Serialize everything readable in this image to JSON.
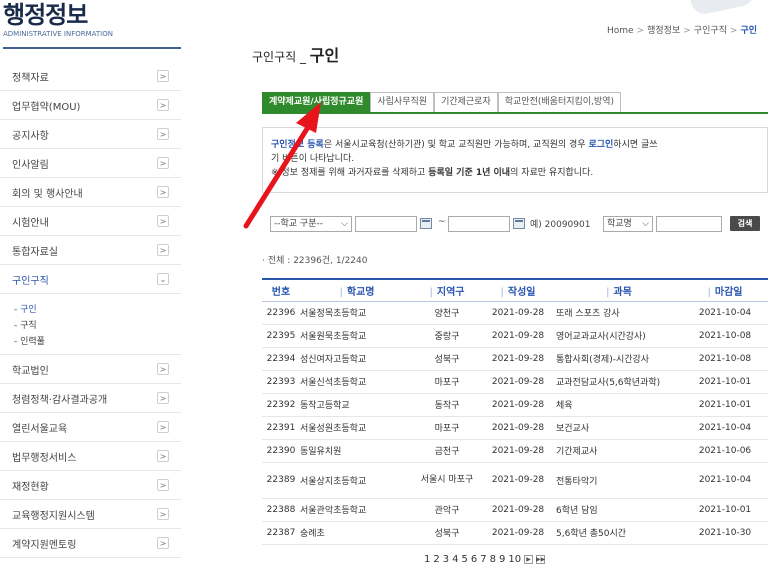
{
  "sidebar": {
    "title_ko": "행정정보",
    "title_en": "ADMINISTRATIVE INFORMATION",
    "items": [
      {
        "label": "정책자료"
      },
      {
        "label": "업무협약(MOU)"
      },
      {
        "label": "공지사항"
      },
      {
        "label": "인사알림"
      },
      {
        "label": "회의 및 행사안내"
      },
      {
        "label": "시험안내"
      },
      {
        "label": "통합자료실"
      },
      {
        "label": "구인구직"
      },
      {
        "label": "학교법인"
      },
      {
        "label": "청렴정책·감사결과공개"
      },
      {
        "label": "열린서울교육"
      },
      {
        "label": "법무행정서비스"
      },
      {
        "label": "재정현황"
      },
      {
        "label": "교육행정지원시스템"
      },
      {
        "label": "계약지원멘토링"
      }
    ],
    "submenu": [
      "- 구인",
      "- 구직",
      "- 인력풀"
    ]
  },
  "breadcrumb": [
    "Home",
    "행정정보",
    "구인구직",
    "구인"
  ],
  "page": {
    "title_prefix": "구인구직 _ ",
    "title_main": "구인"
  },
  "tabs": [
    "계약제교원/사립정규교원",
    "사립사무직원",
    "기간제근로자",
    "학교안전(배움터지킴이,방역)"
  ],
  "notice": {
    "l1_a": "구인정보 등록",
    "l1_b": "은 서울시교육청(산하기관) 및 학교 교직원만 가능하며, 교직원의 경우 ",
    "l1_c": "로그인",
    "l1_d": "하시면 글쓰",
    "l2": "기 버튼이 나타납니다.",
    "l3_a": "※ 정보 정제를 위해 과거자료를 삭제하고 ",
    "l3_b": "등록일 기준 1년 이내",
    "l3_c": "의 자료만 유지합니다."
  },
  "search": {
    "school_type": "--학교 구분--",
    "tilde": "~",
    "example": "예) 20090901",
    "field": "학교명",
    "button": "검색"
  },
  "total": "전체 : 22396건, 1/2240",
  "table": {
    "headers": [
      "번호",
      "학교명",
      "지역구",
      "작성일",
      "과목",
      "마감일"
    ],
    "rows": [
      [
        "22396",
        "서울정목초등학교",
        "양천구",
        "2021-09-28",
        "또래 스포츠 강사",
        "2021-10-04"
      ],
      [
        "22395",
        "서울원묵초등학교",
        "중랑구",
        "2021-09-28",
        "영어교과교사(시간강사)",
        "2021-10-08"
      ],
      [
        "22394",
        "성신여자고등학교",
        "성북구",
        "2021-09-28",
        "통합사회(경제)-시간강사",
        "2021-10-08"
      ],
      [
        "22393",
        "서울신석초등학교",
        "마포구",
        "2021-09-28",
        "교과전담교사(5,6학년과학)",
        "2021-10-01"
      ],
      [
        "22392",
        "동작고등학교",
        "동작구",
        "2021-09-28",
        "체육",
        "2021-10-01"
      ],
      [
        "22391",
        "서울성원초등학교",
        "마포구",
        "2021-09-28",
        "보건교사",
        "2021-10-04"
      ],
      [
        "22390",
        "동일유치원",
        "금천구",
        "2021-09-28",
        "기간제교사",
        "2021-10-06"
      ],
      [
        "22389",
        "서울상지초등학교",
        "서울시 마포구",
        "2021-09-28",
        "전통타악기",
        "2021-10-04"
      ],
      [
        "22388",
        "서울관악초등학교",
        "관악구",
        "2021-09-28",
        "6학년 담임",
        "2021-10-01"
      ],
      [
        "22387",
        "숭례초",
        "성북구",
        "2021-09-28",
        "5,6학년 총50시간",
        "2021-10-30"
      ]
    ]
  },
  "pagination": [
    "1",
    "2",
    "3",
    "4",
    "5",
    "6",
    "7",
    "8",
    "9",
    "10"
  ],
  "colors": {
    "accent": "#2a56b0",
    "tab_active": "#2f8a2b",
    "annotation": "#e8141c"
  }
}
